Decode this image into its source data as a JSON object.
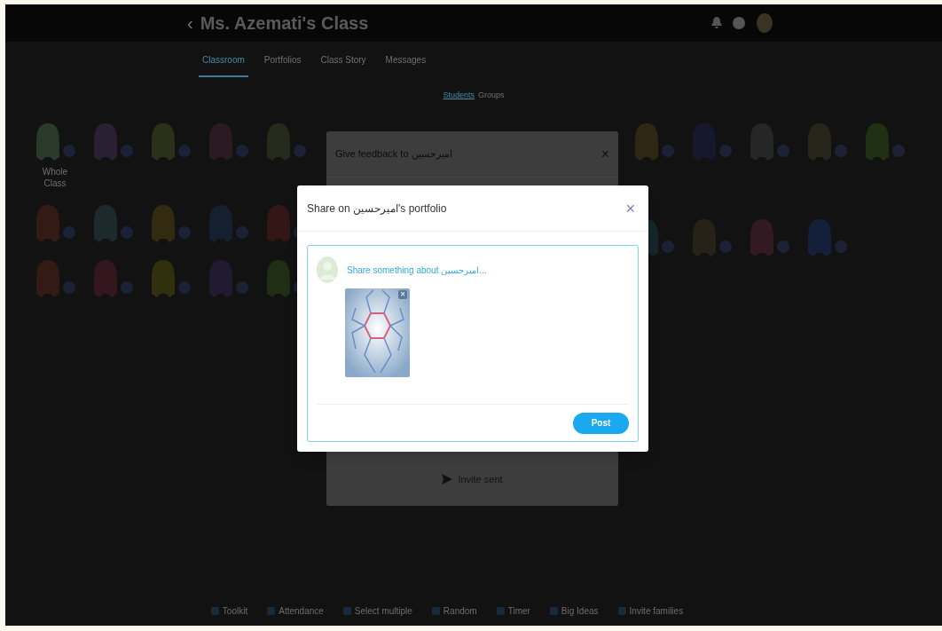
{
  "header": {
    "back": "‹",
    "title": "Ms. Azemati's Class"
  },
  "nav_tabs": [
    {
      "label": "Classroom",
      "selected": true
    },
    {
      "label": "Portfolios",
      "selected": false
    },
    {
      "label": "Class Story",
      "selected": false
    },
    {
      "label": "Messages",
      "selected": false
    }
  ],
  "view_toggle": [
    {
      "label": "Students",
      "selected": true
    },
    {
      "label": "Groups",
      "selected": false
    }
  ],
  "students_left": [
    {
      "name": "Whole Class",
      "color": "#2a3a2a"
    },
    {
      "color": "#2a1f33"
    },
    {
      "color": "#2b3018"
    },
    {
      "color": "#2c1a22"
    },
    {
      "color": "#262a1a"
    },
    {
      "color": "#331a14"
    },
    {
      "color": "#1d2a2c"
    },
    {
      "color": "#332a12"
    },
    {
      "color": "#14202e"
    },
    {
      "color": "#331616"
    },
    {
      "color": "#331a14"
    },
    {
      "color": "#33161e"
    },
    {
      "color": "#30300f"
    },
    {
      "color": "#221a30"
    },
    {
      "color": "#1f2e14"
    }
  ],
  "students_right": [
    {
      "color": "#2e2812"
    },
    {
      "color": "#16182e"
    },
    {
      "color": "#262626"
    },
    {
      "color": "#28261a"
    },
    {
      "color": "#1f3014"
    },
    {
      "color": "#14262c"
    },
    {
      "color": "#262218"
    },
    {
      "color": "#331a22"
    },
    {
      "color": "#14203a"
    }
  ],
  "feedback_dialog": {
    "title": "Give feedback to امیرحسین",
    "close": "×",
    "status": "Invite sent"
  },
  "share_dialog": {
    "title": "Share on امیرحسین's portfolio",
    "close": "×",
    "placeholder": "Share something about امیرحسین...",
    "remove_photo": "×",
    "button": "Post"
  },
  "toolbar": [
    "Toolkit",
    "Attendance",
    "Select multiple",
    "Random",
    "Timer",
    "Big Ideas",
    "Invite families"
  ]
}
